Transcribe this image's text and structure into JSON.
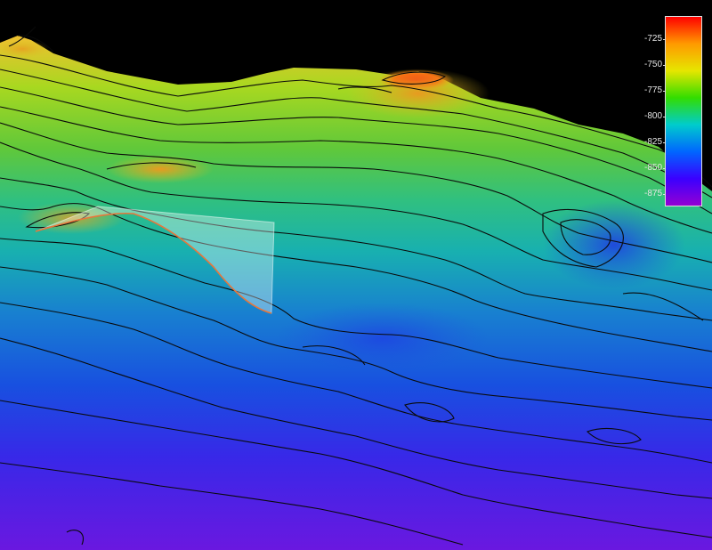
{
  "legend": {
    "labels": [
      "-725",
      "-750",
      "-775",
      "-800",
      "-825",
      "-850",
      "-875"
    ],
    "colors": [
      "#ff0000",
      "#ff9a00",
      "#e6e600",
      "#33dd00",
      "#00cccc",
      "#0066ff",
      "#3a00ff",
      "#9400d3"
    ]
  },
  "scene": {
    "description_colors": {
      "background": "#000000",
      "contour": "#0a0a0a",
      "profile_plane": "#ffffff",
      "profile_line": "#e8763a"
    }
  }
}
